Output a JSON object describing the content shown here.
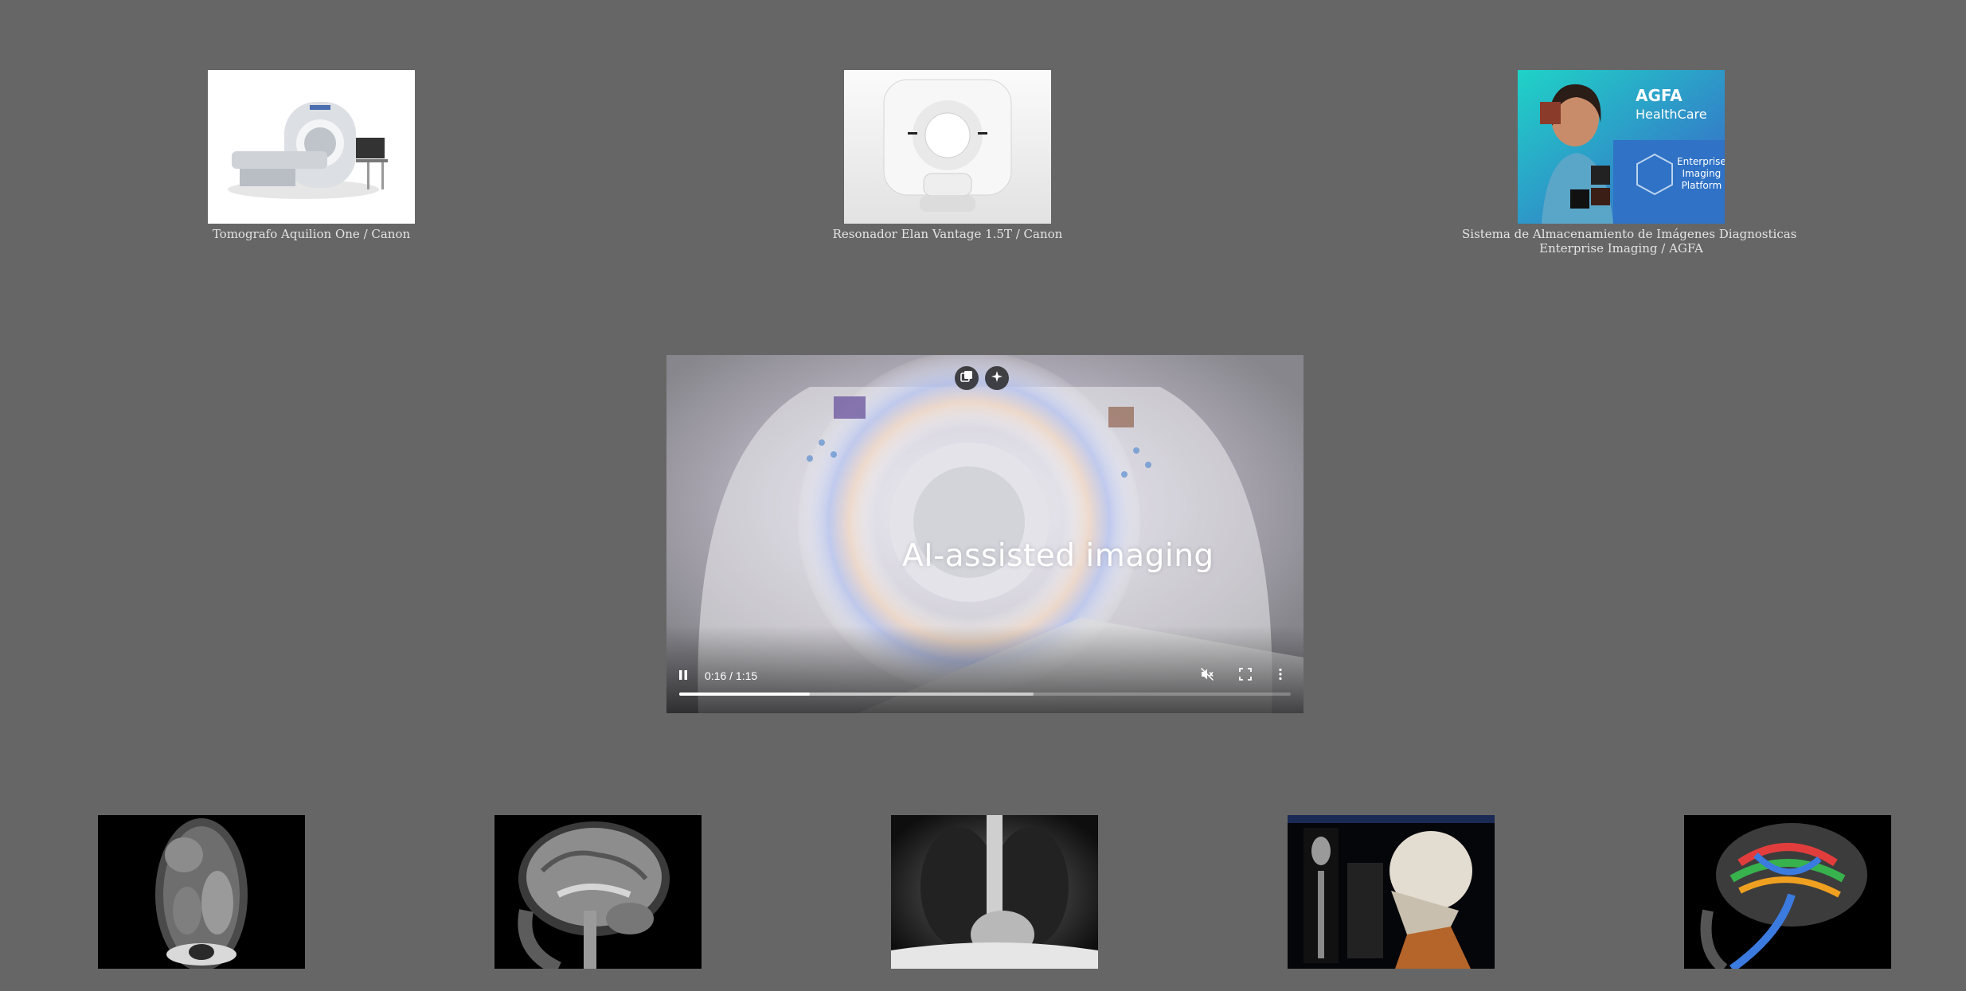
{
  "colors": {
    "background": "#666666",
    "caption_text": "#e4e4e4"
  },
  "products": [
    {
      "caption_lines": [
        "Tomografo Aquilion One / Canon"
      ],
      "image": "ct-scanner-image"
    },
    {
      "caption_lines": [
        "Resonador Elan Vantage 1.5T / Canon"
      ],
      "image": "mri-scanner-image"
    },
    {
      "caption_lines": [
        "Sistema de Almacenamiento de Imágenes Diagnosticas",
        "Enterprise Imaging / AGFA"
      ],
      "image": "agfa-banner-image",
      "banner": {
        "brand": "AGFA",
        "brand_sub": "HealthCare",
        "product_lines": [
          "Enterprise",
          "Imaging",
          "Platform"
        ]
      }
    }
  ],
  "video": {
    "overlay_text": "AI-assisted imaging",
    "time": "0:16 / 1:15",
    "played_fraction": 0.213,
    "buffered_fraction": 0.58,
    "controls": [
      "pause-icon",
      "mute-icon",
      "fullscreen-icon",
      "more-options-icon"
    ],
    "top_buttons": [
      "picture-in-picture-icon",
      "enhance-icon"
    ]
  },
  "gallery": [
    {
      "image": "abdominal-ct-coronal-image"
    },
    {
      "image": "brain-mri-sagittal-image"
    },
    {
      "image": "chest-xray-image"
    },
    {
      "image": "3d-skull-ct-reconstruction-image"
    },
    {
      "image": "brain-tractography-image"
    }
  ]
}
